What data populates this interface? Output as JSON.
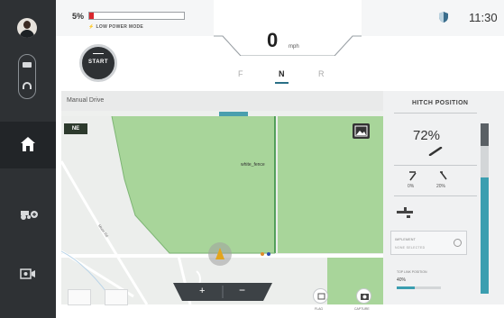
{
  "status": {
    "battery_pct": "5%",
    "battery_level": 0.05,
    "low_power_label": "LOW POWER MODE",
    "time": "11:30"
  },
  "drive": {
    "speed": "0",
    "speed_unit": "mph",
    "gears": [
      "F",
      "N",
      "R"
    ],
    "active_gear": "N",
    "start_label": "START"
  },
  "map": {
    "title": "Manual Drive",
    "heading": "NE",
    "fence_label": "white_fence",
    "road_label": "Moon Rd",
    "zoom_plus": "+",
    "zoom_minus": "−"
  },
  "hitch": {
    "title": "HITCH POSITION",
    "position": "72%",
    "position_level": 0.72,
    "range_min": "0%",
    "range_max": "20%",
    "implement_label": "IMPLEMENT",
    "implement_value": "NONE SELECTED",
    "top_link_label": "TOP LINK POSITION",
    "top_link_value": "40%",
    "top_link_level": 0.4
  },
  "actions": {
    "flag_label": "FLAG",
    "capture_label": "CAPTURE"
  },
  "colors": {
    "sidebar": "#2e3134",
    "accent": "#3b9eb0",
    "alert": "#d9272e",
    "field": "#a8d59a"
  }
}
